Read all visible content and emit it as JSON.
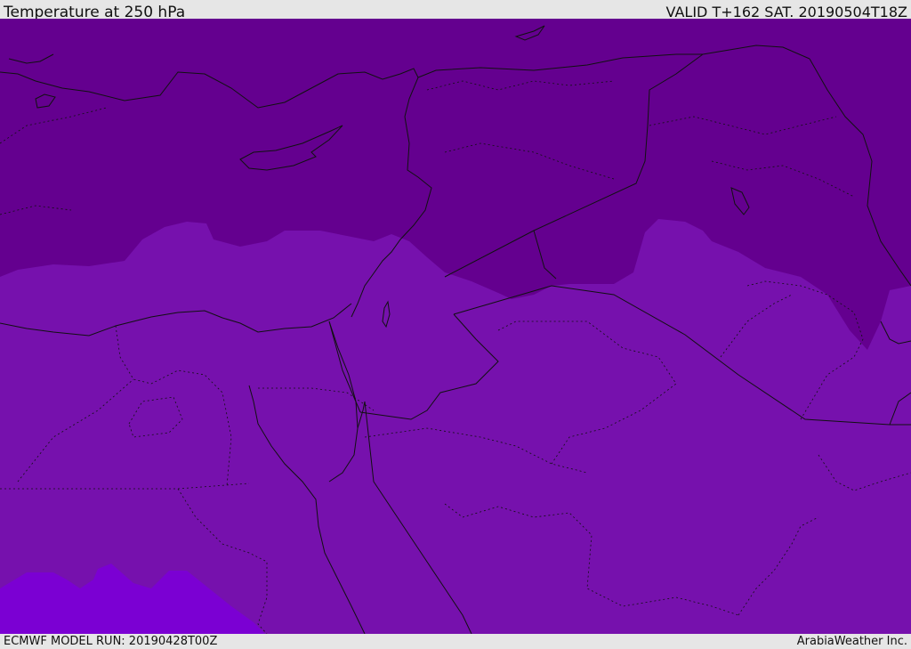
{
  "header": {
    "title": "Temperature at 250 hPa",
    "valid_time": "VALID T+162 SAT. 20190504T18Z"
  },
  "footer": {
    "model_run": "ECMWF MODEL RUN: 20190428T00Z",
    "credit": "ArabiaWeather Inc."
  },
  "map": {
    "colors": {
      "band_cold": "#64008f",
      "band_mid": "#7611ad",
      "band_warm": "#7b00d3",
      "line": "#111111"
    },
    "icons": [
      "land-boundary",
      "coastline",
      "temperature-band"
    ]
  }
}
